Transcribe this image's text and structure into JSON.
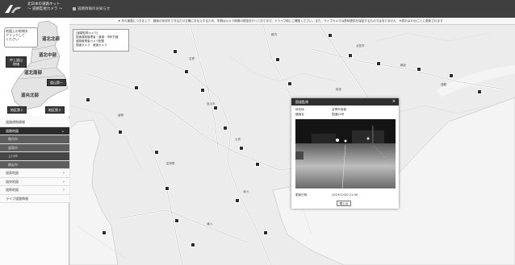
{
  "header": {
    "brand_line1": "北日本の道路ネット",
    "brand_line2": "〜 道路監視カメラ 〜",
    "link": "道路情報のお知らせ"
  },
  "notice": "★ 冬の道路につきまして　路面の状況をできるだけ正確にお伝えするため、冬期はカメラ映像の配信を行っております。ドライブ前にご確認ください。また、ライブカメラは常時提供を保証するものではありません　※表示は10分ごとに更新されます",
  "sidebar": {
    "hint_line1": "地図上の地域を",
    "hint_line2": "クリックして",
    "hint_line3": "ください",
    "regions": {
      "r1": "道北北部",
      "r2": "道北中部",
      "r3": "道北南部",
      "r4": "道央北部",
      "btn1": "中上道山\n地域",
      "btn2": "道山第一",
      "btn3": "地区第１",
      "btn4": "地区第２"
    },
    "menu": [
      {
        "label": "道路規制情報",
        "type": "plain"
      },
      {
        "label": "道路地図",
        "type": "active",
        "chev": "⌄"
      },
      {
        "label": "稚内市",
        "type": "sub"
      },
      {
        "label": "留萌市",
        "type": "sub"
      },
      {
        "label": "上川市",
        "type": "sub selected"
      },
      {
        "label": "網走市",
        "type": "sub"
      },
      {
        "label": "道東地図",
        "type": "plain",
        "chev": "›"
      },
      {
        "label": "道央地図",
        "type": "plain",
        "chev": "›"
      },
      {
        "label": "道南地図",
        "type": "plain",
        "chev": "›"
      },
      {
        "label": "ライブ道路情報",
        "type": "plain"
      }
    ]
  },
  "legend": {
    "title": "[道路監視カメラ]",
    "line1": "国道道路管理者・道道・市町村道",
    "line2": "道路管理者カメラ配置",
    "line3": "国道カメラ　道道カメラ"
  },
  "popup": {
    "title": "国道監視",
    "close": "×",
    "row1_label": "所在地",
    "row1_value": "名寄市西條",
    "row2_label": "路線名",
    "row2_value": "国道40号",
    "updated_label": "更新日時",
    "updated_value": "2019/12/20 21:30",
    "button": "閉じる"
  },
  "map_labels": [
    "名寄",
    "旭川市",
    "北見市",
    "網走",
    "稚内",
    "留萌",
    "士別",
    "富良野",
    "深川",
    "滝川",
    "紋別",
    "遠軽"
  ]
}
